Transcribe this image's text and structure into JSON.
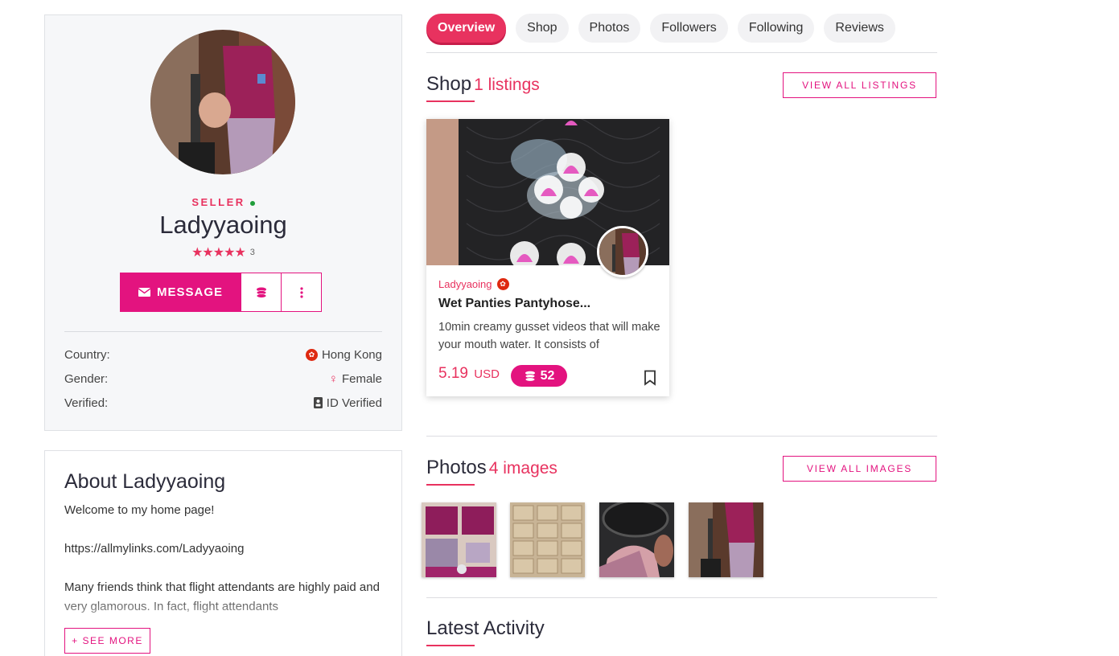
{
  "profile": {
    "role": "SELLER",
    "username": "Ladyyaoing",
    "stars": "★★★★★",
    "review_count": "3",
    "message_label": "MESSAGE",
    "info": [
      {
        "label": "Country:",
        "value": "Hong Kong",
        "icon": "hong-kong-flag-icon"
      },
      {
        "label": "Gender:",
        "value": "Female",
        "icon": "female-icon"
      },
      {
        "label": "Verified:",
        "value": "ID Verified",
        "icon": "id-card-icon"
      }
    ]
  },
  "about": {
    "title": "About Ladyyaoing",
    "paragraphs": [
      "Welcome to my home page!",
      "https://allmylinks.com/Ladyyaoing",
      "Many friends think that flight attendants are highly paid and very glamorous. In fact, flight attendants"
    ],
    "see_more_label": "+ SEE MORE"
  },
  "tabs": [
    {
      "label": "Overview",
      "active": true
    },
    {
      "label": "Shop",
      "active": false
    },
    {
      "label": "Photos",
      "active": false
    },
    {
      "label": "Followers",
      "active": false
    },
    {
      "label": "Following",
      "active": false
    },
    {
      "label": "Reviews",
      "active": false
    }
  ],
  "shop": {
    "title": "Shop",
    "count_label": "1 listings",
    "view_all_label": "VIEW ALL LISTINGS",
    "listing": {
      "seller": "Ladyyaoing",
      "title": "Wet Panties Pantyhose...",
      "description": "10min creamy gusset videos that will make your mouth water. It consists of",
      "price": "5.19",
      "currency": "USD",
      "coins": "52"
    }
  },
  "photos": {
    "title": "Photos",
    "count_label": "4 images",
    "view_all_label": "VIEW ALL IMAGES"
  },
  "activity": {
    "title": "Latest Activity"
  },
  "colors": {
    "accent": "#e8325f",
    "brand_button": "#e3137f",
    "card_bg": "#f6f7f9"
  }
}
